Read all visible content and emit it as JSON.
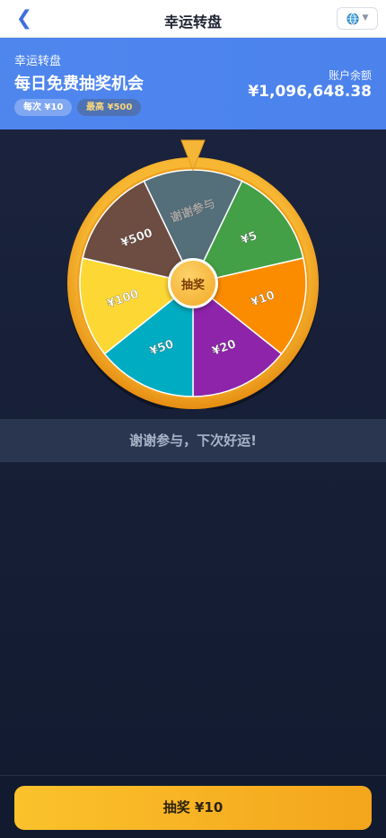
{
  "header": {
    "title": "幸运转盘",
    "back_icon": "chevron-left-icon",
    "lang_icon": "globe-icon"
  },
  "banner": {
    "subtitle": "幸运转盘",
    "title": "每日免费抽奖机会",
    "tag_cost": "每次 ¥10",
    "tag_max": "最高 ¥500",
    "balance_label": "账户余额",
    "balance_value": "¥1,096,648.38"
  },
  "wheel": {
    "center_label": "抽奖",
    "segments": [
      {
        "label": "谢谢参与",
        "color": "#546e7a"
      },
      {
        "label": "¥5",
        "color": "#43a047"
      },
      {
        "label": "¥10",
        "color": "#fb8c00"
      },
      {
        "label": "¥20",
        "color": "#8e24aa"
      },
      {
        "label": "¥50",
        "color": "#00acc1"
      },
      {
        "label": "¥100",
        "color": "#fdd835"
      },
      {
        "label": "¥500",
        "color": "#6d4c41"
      }
    ],
    "rim_color": "#f5a623",
    "pointer_color": "#f5b638"
  },
  "result": {
    "text": "谢谢参与，下次好运!"
  },
  "footer": {
    "spin_label": "抽奖 ¥10"
  }
}
